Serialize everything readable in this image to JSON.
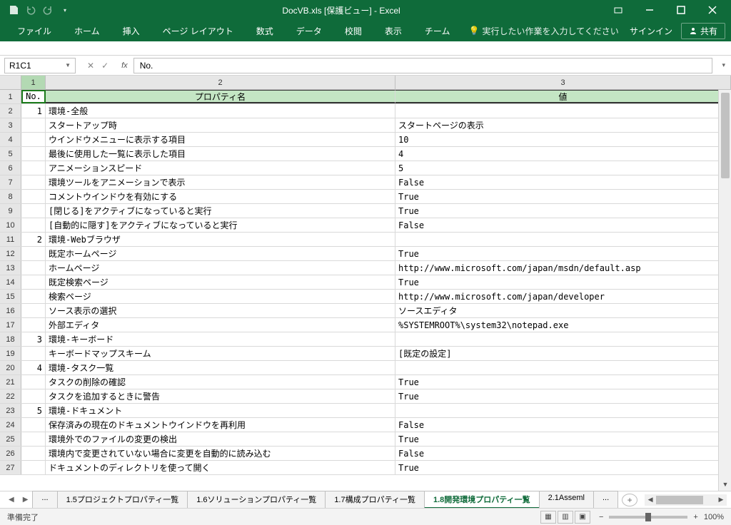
{
  "title": "DocVB.xls  [保護ビュー] - Excel",
  "ribbon": {
    "tabs": [
      "ファイル",
      "ホーム",
      "挿入",
      "ページ レイアウト",
      "数式",
      "データ",
      "校閲",
      "表示",
      "チーム"
    ],
    "tellme": "実行したい作業を入力してください",
    "signin": "サインイン",
    "share": "共有"
  },
  "namebox": "R1C1",
  "formula": "No.",
  "columns": [
    "1",
    "2",
    "3"
  ],
  "headers": {
    "no": "No.",
    "prop": "プロパティ名",
    "val": "値"
  },
  "rows": [
    {
      "n": "1",
      "no": "1",
      "p": "環境-全般",
      "v": ""
    },
    {
      "n": "2",
      "no": "",
      "p": "スタートアップ時",
      "v": "スタートページの表示"
    },
    {
      "n": "3",
      "no": "",
      "p": "ウインドウメニューに表示する項目",
      "v": "10"
    },
    {
      "n": "4",
      "no": "",
      "p": "最後に使用した一覧に表示した項目",
      "v": "4"
    },
    {
      "n": "5",
      "no": "",
      "p": "アニメーションスピード",
      "v": "5"
    },
    {
      "n": "6",
      "no": "",
      "p": "環境ツールをアニメーションで表示",
      "v": "False"
    },
    {
      "n": "7",
      "no": "",
      "p": "コメントウインドウを有効にする",
      "v": "True"
    },
    {
      "n": "8",
      "no": "",
      "p": "[閉じる]をアクティブになっていると実行",
      "v": "True"
    },
    {
      "n": "9",
      "no": "",
      "p": "[自動的に隠す]をアクティブになっていると実行",
      "v": "False"
    },
    {
      "n": "10",
      "no": "2",
      "p": "環境-Webブラウザ",
      "v": ""
    },
    {
      "n": "11",
      "no": "",
      "p": "既定ホームページ",
      "v": "True"
    },
    {
      "n": "12",
      "no": "",
      "p": "ホームページ",
      "v": "http://www.microsoft.com/japan/msdn/default.asp"
    },
    {
      "n": "13",
      "no": "",
      "p": "既定検索ページ",
      "v": "True"
    },
    {
      "n": "14",
      "no": "",
      "p": "検索ページ",
      "v": "http://www.microsoft.com/japan/developer"
    },
    {
      "n": "15",
      "no": "",
      "p": "ソース表示の選択",
      "v": "ソースエディタ"
    },
    {
      "n": "16",
      "no": "",
      "p": "外部エディタ",
      "v": "%SYSTEMROOT%\\system32\\notepad.exe"
    },
    {
      "n": "17",
      "no": "3",
      "p": "環境-キーボード",
      "v": ""
    },
    {
      "n": "18",
      "no": "",
      "p": "キーボードマップスキーム",
      "v": "[既定の設定]"
    },
    {
      "n": "19",
      "no": "4",
      "p": "環境-タスク一覧",
      "v": ""
    },
    {
      "n": "20",
      "no": "",
      "p": "タスクの削除の確認",
      "v": "True"
    },
    {
      "n": "21",
      "no": "",
      "p": "タスクを追加するときに警告",
      "v": "True"
    },
    {
      "n": "22",
      "no": "5",
      "p": "環境-ドキュメント",
      "v": ""
    },
    {
      "n": "23",
      "no": "",
      "p": "保存済みの現在のドキュメントウインドウを再利用",
      "v": "False"
    },
    {
      "n": "24",
      "no": "",
      "p": "環境外でのファイルの変更の検出",
      "v": "True"
    },
    {
      "n": "25",
      "no": "",
      "p": "環境内で変更されていない場合に変更を自動的に読み込む",
      "v": "False"
    },
    {
      "n": "26",
      "no": "",
      "p": "ドキュメントのディレクトリを使って開く",
      "v": "True"
    }
  ],
  "sheets": [
    {
      "label": "...",
      "active": false
    },
    {
      "label": "1.5プロジェクトプロパティ一覧",
      "active": false
    },
    {
      "label": "1.6ソリューションプロパティ一覧",
      "active": false
    },
    {
      "label": "1.7構成プロパティ一覧",
      "active": false
    },
    {
      "label": "1.8開発環境プロパティ一覧",
      "active": true
    },
    {
      "label": "2.1Asseml",
      "active": false
    },
    {
      "label": "...",
      "active": false
    }
  ],
  "status": {
    "ready": "準備完了",
    "zoom": "100%"
  }
}
